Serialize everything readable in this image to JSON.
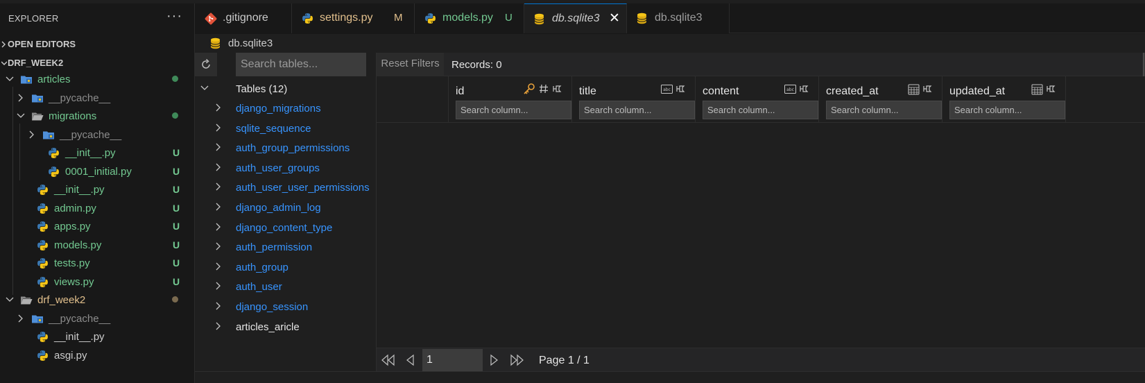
{
  "sidebar": {
    "title": "EXPLORER",
    "more": "···",
    "sections": {
      "open_editors": "OPEN EDITORS",
      "project": "DRF_WEEK2"
    },
    "rows": [
      {
        "label": "articles",
        "icon": "folder-blue-icon",
        "color": "#73c991",
        "status": "dot",
        "status_color": "#3f8a59"
      },
      {
        "label": "__pycache__",
        "icon": "folder-blue-icon",
        "color": "#8c8c8c"
      },
      {
        "label": "migrations",
        "icon": "folder-open-icon",
        "color": "#73c991",
        "status": "dot",
        "status_color": "#3f8a59"
      },
      {
        "label": "__pycache__",
        "icon": "folder-blue-icon",
        "color": "#8c8c8c"
      },
      {
        "label": "__init__.py",
        "icon": "python-icon",
        "color": "#73c991",
        "badge": "U"
      },
      {
        "label": "0001_initial.py",
        "icon": "python-icon",
        "color": "#73c991",
        "badge": "U"
      },
      {
        "label": "__init__.py",
        "icon": "python-icon",
        "color": "#73c991",
        "badge": "U"
      },
      {
        "label": "admin.py",
        "icon": "python-icon",
        "color": "#73c991",
        "badge": "U"
      },
      {
        "label": "apps.py",
        "icon": "python-icon",
        "color": "#73c991",
        "badge": "U"
      },
      {
        "label": "models.py",
        "icon": "python-icon",
        "color": "#73c991",
        "badge": "U"
      },
      {
        "label": "tests.py",
        "icon": "python-icon",
        "color": "#73c991",
        "badge": "U"
      },
      {
        "label": "views.py",
        "icon": "python-icon",
        "color": "#73c991",
        "badge": "U"
      },
      {
        "label": "drf_week2",
        "icon": "folder-open-icon",
        "color": "#e2c08d",
        "status": "dot",
        "status_color": "#7a6a4f"
      },
      {
        "label": "__pycache__",
        "icon": "folder-blue-icon",
        "color": "#8c8c8c"
      },
      {
        "label": "__init__.py",
        "icon": "python-icon",
        "color": "#cccccc"
      },
      {
        "label": "asgi.py",
        "icon": "python-icon",
        "color": "#cccccc"
      }
    ]
  },
  "tabs": [
    {
      "label": ".gitignore",
      "icon": "git-icon",
      "color": "#cccccc"
    },
    {
      "label": "settings.py",
      "icon": "python-icon",
      "color": "#e2c08d",
      "badge": "M",
      "badge_color": "#e2c08d"
    },
    {
      "label": "models.py",
      "icon": "python-icon",
      "color": "#73c991",
      "badge": "U",
      "badge_color": "#73c991"
    },
    {
      "label": "db.sqlite3",
      "icon": "database-icon",
      "color": "#cccccc",
      "active": true,
      "close": "✕"
    },
    {
      "label": "db.sqlite3",
      "icon": "database-icon",
      "color": "#9d9d9d"
    }
  ],
  "breadcrumb": {
    "label": "db.sqlite3"
  },
  "db": {
    "search_placeholder": "Search tables...",
    "tables_label": "Tables (12)",
    "tables": [
      "django_migrations",
      "sqlite_sequence",
      "auth_group_permissions",
      "auth_user_groups",
      "auth_user_user_permissions",
      "django_admin_log",
      "django_content_type",
      "auth_permission",
      "auth_group",
      "auth_user",
      "django_session",
      "articles_aricle"
    ],
    "reset_label": "Reset Filters",
    "records_label": "Records: 0",
    "columns": [
      {
        "name": "id",
        "type": "key",
        "placeholder": "Search column..."
      },
      {
        "name": "title",
        "type": "text",
        "placeholder": "Search column..."
      },
      {
        "name": "content",
        "type": "text",
        "placeholder": "Search column..."
      },
      {
        "name": "created_at",
        "type": "date",
        "placeholder": "Search column..."
      },
      {
        "name": "updated_at",
        "type": "date",
        "placeholder": "Search column..."
      }
    ],
    "page_value": "1",
    "page_label": "Page 1 / 1"
  },
  "colors": {
    "link": "#3794ff",
    "accent": "#0078d4",
    "added": "#73c991",
    "modified": "#e2c08d"
  }
}
